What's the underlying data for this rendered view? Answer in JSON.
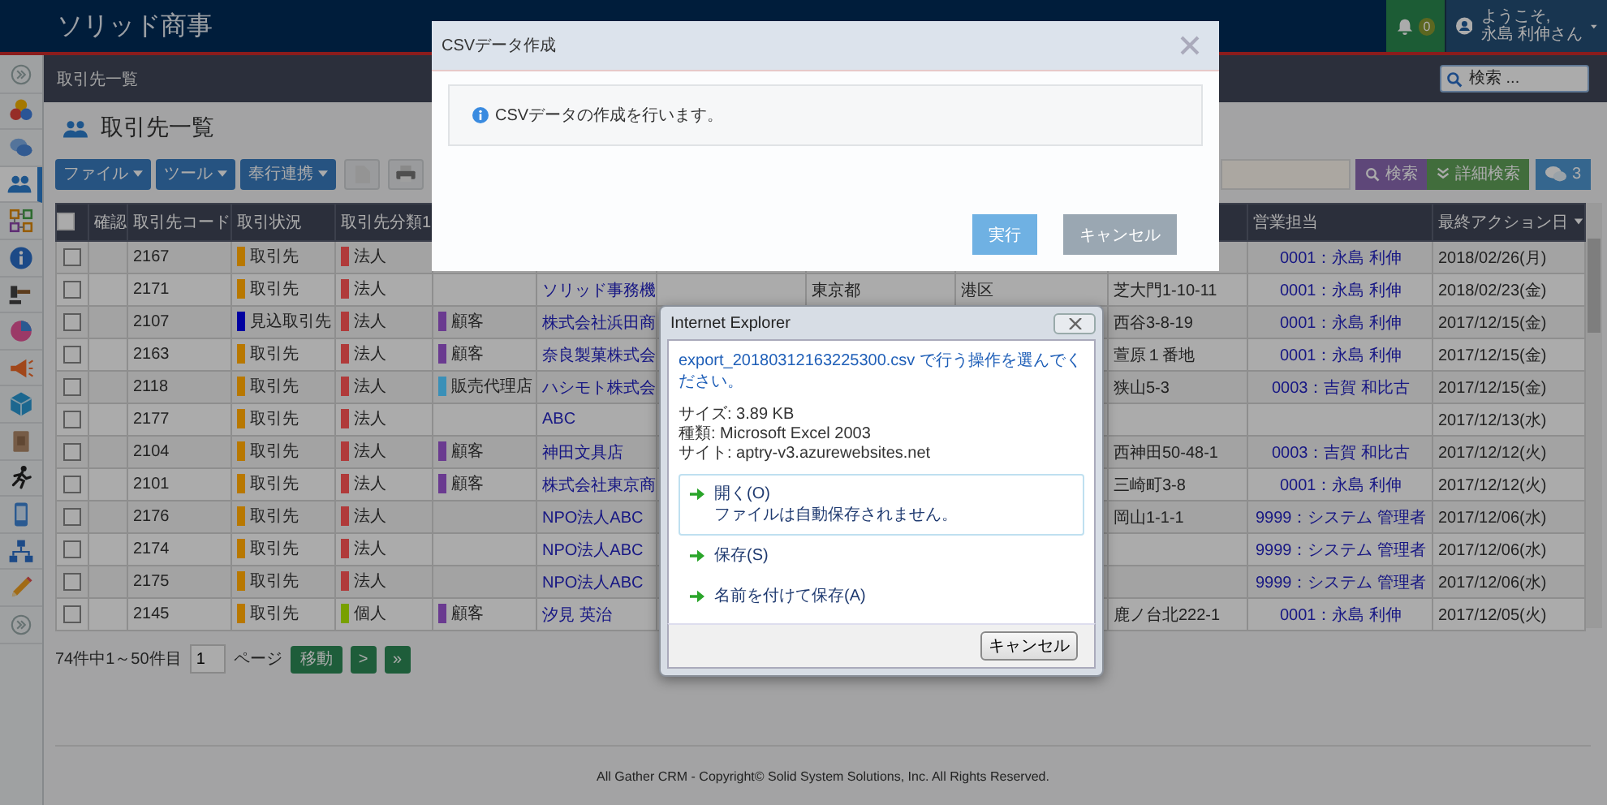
{
  "header": {
    "brand": "ソリッド商事",
    "notifications": "0",
    "greeting": "ようこそ,",
    "user": "永島 利伸さん"
  },
  "sidebar": {
    "items": [
      {
        "selected": false
      },
      {
        "selected": false
      },
      {
        "selected": false
      },
      {
        "selected": true
      },
      {
        "selected": false
      },
      {
        "selected": false
      },
      {
        "selected": false
      },
      {
        "selected": false
      },
      {
        "selected": false
      },
      {
        "selected": false
      },
      {
        "selected": false
      },
      {
        "selected": false
      },
      {
        "selected": false
      },
      {
        "selected": false
      },
      {
        "selected": false
      },
      {
        "selected": false
      }
    ]
  },
  "breadcrumb": {
    "title": "取引先一覧",
    "search_placeholder": "検索 ..."
  },
  "page_title": "取引先一覧",
  "toolbar": {
    "menus": [
      {
        "label": "ファイル"
      },
      {
        "label": "ツール"
      },
      {
        "label": "奉行連携"
      }
    ],
    "search": "検索",
    "advanced_search": "詳細検索",
    "comments": "3"
  },
  "table": {
    "all_checked": false,
    "headers": {
      "confirm": "確認",
      "code": "取引先コード",
      "status": "取引状況",
      "category1": "取引先分類1",
      "owner": "営業担当",
      "last_action": "最終アクション日"
    },
    "last_action_sort_descending": true,
    "rows": [
      {
        "checked": false,
        "code": "2167",
        "status": {
          "label": "取引先",
          "color": "#b87800"
        },
        "category1": {
          "label": "法人",
          "color": "#b03a3a"
        },
        "owner": "0001：永島 利伸",
        "last_action": "2018/02/26(月)"
      },
      {
        "checked": false,
        "code": "2171",
        "status": {
          "label": "取引先",
          "color": "#b87800"
        },
        "category1": {
          "label": "法人",
          "color": "#b03a3a"
        },
        "name": "ソリッド事務機",
        "prefecture": "東京都",
        "city": "港区",
        "address": "芝大門1-10-11",
        "owner": "0001：永島 利伸",
        "last_action": "2018/02/23(金)"
      },
      {
        "checked": false,
        "code": "2107",
        "status": {
          "label": "見込取引先",
          "color": "#0000a0"
        },
        "category1": {
          "label": "法人",
          "color": "#b03a3a"
        },
        "category2": {
          "label": "顧客",
          "color": "#6a3a90"
        },
        "name": "株式会社浜田商",
        "address": "西谷3-8-19",
        "owner": "0001：永島 利伸",
        "last_action": "2017/12/15(金)"
      },
      {
        "checked": false,
        "code": "2163",
        "status": {
          "label": "取引先",
          "color": "#b87800"
        },
        "category1": {
          "label": "法人",
          "color": "#b03a3a"
        },
        "category2": {
          "label": "顧客",
          "color": "#6a3a90"
        },
        "name": "奈良製菓株式会",
        "address": "萱原１番地",
        "owner": "0001：永島 利伸",
        "last_action": "2017/12/15(金)"
      },
      {
        "checked": false,
        "code": "2118",
        "status": {
          "label": "取引先",
          "color": "#b87800"
        },
        "category1": {
          "label": "法人",
          "color": "#b03a3a"
        },
        "category2": {
          "label": "販売代理店",
          "color": "#3a90b8"
        },
        "name": "ハシモト株式会",
        "address": "狭山5-3",
        "owner": "0003：吉賀 和比古",
        "last_action": "2017/12/15(金)"
      },
      {
        "checked": false,
        "code": "2177",
        "status": {
          "label": "取引先",
          "color": "#b87800"
        },
        "category1": {
          "label": "法人",
          "color": "#b03a3a"
        },
        "name": "ABC",
        "last_action": "2017/12/13(水)"
      },
      {
        "checked": false,
        "code": "2104",
        "status": {
          "label": "取引先",
          "color": "#b87800"
        },
        "category1": {
          "label": "法人",
          "color": "#b03a3a"
        },
        "category2": {
          "label": "顧客",
          "color": "#6a3a90"
        },
        "name": "神田文具店",
        "address": "西神田50-48-1",
        "owner": "0003：吉賀 和比古",
        "last_action": "2017/12/12(火)"
      },
      {
        "checked": false,
        "code": "2101",
        "status": {
          "label": "取引先",
          "color": "#b87800"
        },
        "category1": {
          "label": "法人",
          "color": "#b03a3a"
        },
        "category2": {
          "label": "顧客",
          "color": "#6a3a90"
        },
        "name": "株式会社東京商",
        "address": "三崎町3-8",
        "owner": "0001：永島 利伸",
        "last_action": "2017/12/12(火)"
      },
      {
        "checked": false,
        "code": "2176",
        "status": {
          "label": "取引先",
          "color": "#b87800"
        },
        "category1": {
          "label": "法人",
          "color": "#b03a3a"
        },
        "name": "NPO法人ABC",
        "address": "岡山1-1-1",
        "owner": "9999：システム 管理者",
        "last_action": "2017/12/06(水)"
      },
      {
        "checked": false,
        "code": "2174",
        "status": {
          "label": "取引先",
          "color": "#b87800"
        },
        "category1": {
          "label": "法人",
          "color": "#b03a3a"
        },
        "name": "NPO法人ABC",
        "owner": "9999：システム 管理者",
        "last_action": "2017/12/06(水)"
      },
      {
        "checked": false,
        "code": "2175",
        "status": {
          "label": "取引先",
          "color": "#b87800"
        },
        "category1": {
          "label": "法人",
          "color": "#b03a3a"
        },
        "name": "NPO法人ABC",
        "owner": "9999：システム 管理者",
        "last_action": "2017/12/06(水)"
      },
      {
        "checked": false,
        "code": "2145",
        "status": {
          "label": "取引先",
          "color": "#b87800"
        },
        "category1": {
          "label": "個人",
          "color": "#78a000"
        },
        "category2": {
          "label": "顧客",
          "color": "#6a3a90"
        },
        "name": "汐見 英治",
        "address": "鹿ノ台北222-1",
        "owner": "0001：永島 利伸",
        "last_action": "2017/12/05(火)"
      }
    ]
  },
  "pagination": {
    "summary": "74件中1～50件目",
    "page": "1",
    "page_label": "ページ",
    "go": "移動",
    "next": ">",
    "last": "»"
  },
  "footer": "All Gather CRM - Copyright© Solid System Solutions, Inc. All Rights Reserved.",
  "csv_dialog": {
    "title": "CSVデータ作成",
    "message": "CSVデータの作成を行います。",
    "buttons": [
      {
        "label": "実行",
        "kind": "primary"
      },
      {
        "label": "キャンセル",
        "kind": "secondary"
      }
    ]
  },
  "ie_dialog": {
    "title": "Internet Explorer",
    "prompt": "export_20180312163225300.csv で行う操作を選んでください。",
    "details": [
      "サイズ: 3.89 KB",
      "種類: Microsoft Excel 2003",
      "サイト: aptry-v3.azurewebsites.net"
    ],
    "options": [
      {
        "label": "開く(O)",
        "note": "ファイルは自動保存されません。",
        "selected": true
      },
      {
        "label": "保存(S)",
        "selected": false
      },
      {
        "label": "名前を付けて保存(A)",
        "selected": false
      }
    ],
    "cancel": "キャンセル"
  }
}
